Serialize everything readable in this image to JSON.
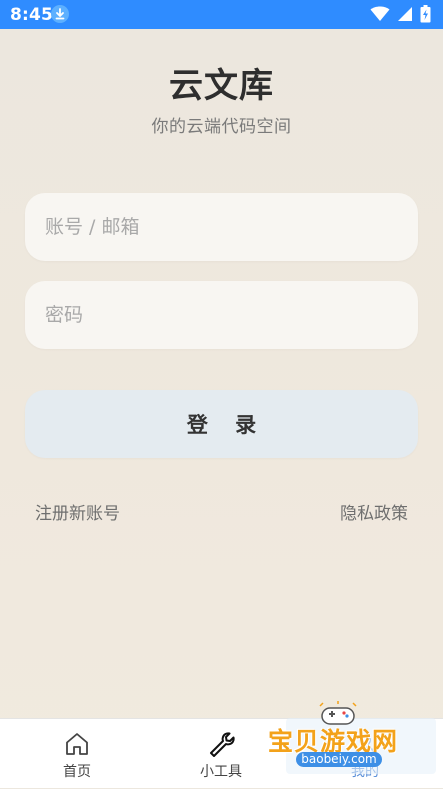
{
  "status_bar": {
    "time": "8:45",
    "icons": [
      "download-icon",
      "wifi-icon",
      "signal-icon",
      "battery-icon"
    ],
    "background_color": "#2f8cff"
  },
  "header": {
    "title": "云文库",
    "subtitle": "你的云端代码空间"
  },
  "form": {
    "account_placeholder": "账号 / 邮箱",
    "account_value": "",
    "password_placeholder": "密码",
    "password_value": "",
    "login_label": "登 录",
    "register_link": "注册新账号",
    "privacy_link": "隐私政策"
  },
  "bottom_nav": {
    "items": [
      {
        "label": "首页",
        "icon": "home-icon"
      },
      {
        "label": "小工具",
        "icon": "wrench-icon"
      },
      {
        "label": "我的",
        "icon": "user-icon"
      }
    ]
  },
  "watermark": {
    "text": "宝贝游戏网",
    "url": "baobeiy.com"
  },
  "colors": {
    "primary": "#2f8cff",
    "login_button_bg": "#e4ebf0",
    "input_bg": "#f8f6f2"
  }
}
